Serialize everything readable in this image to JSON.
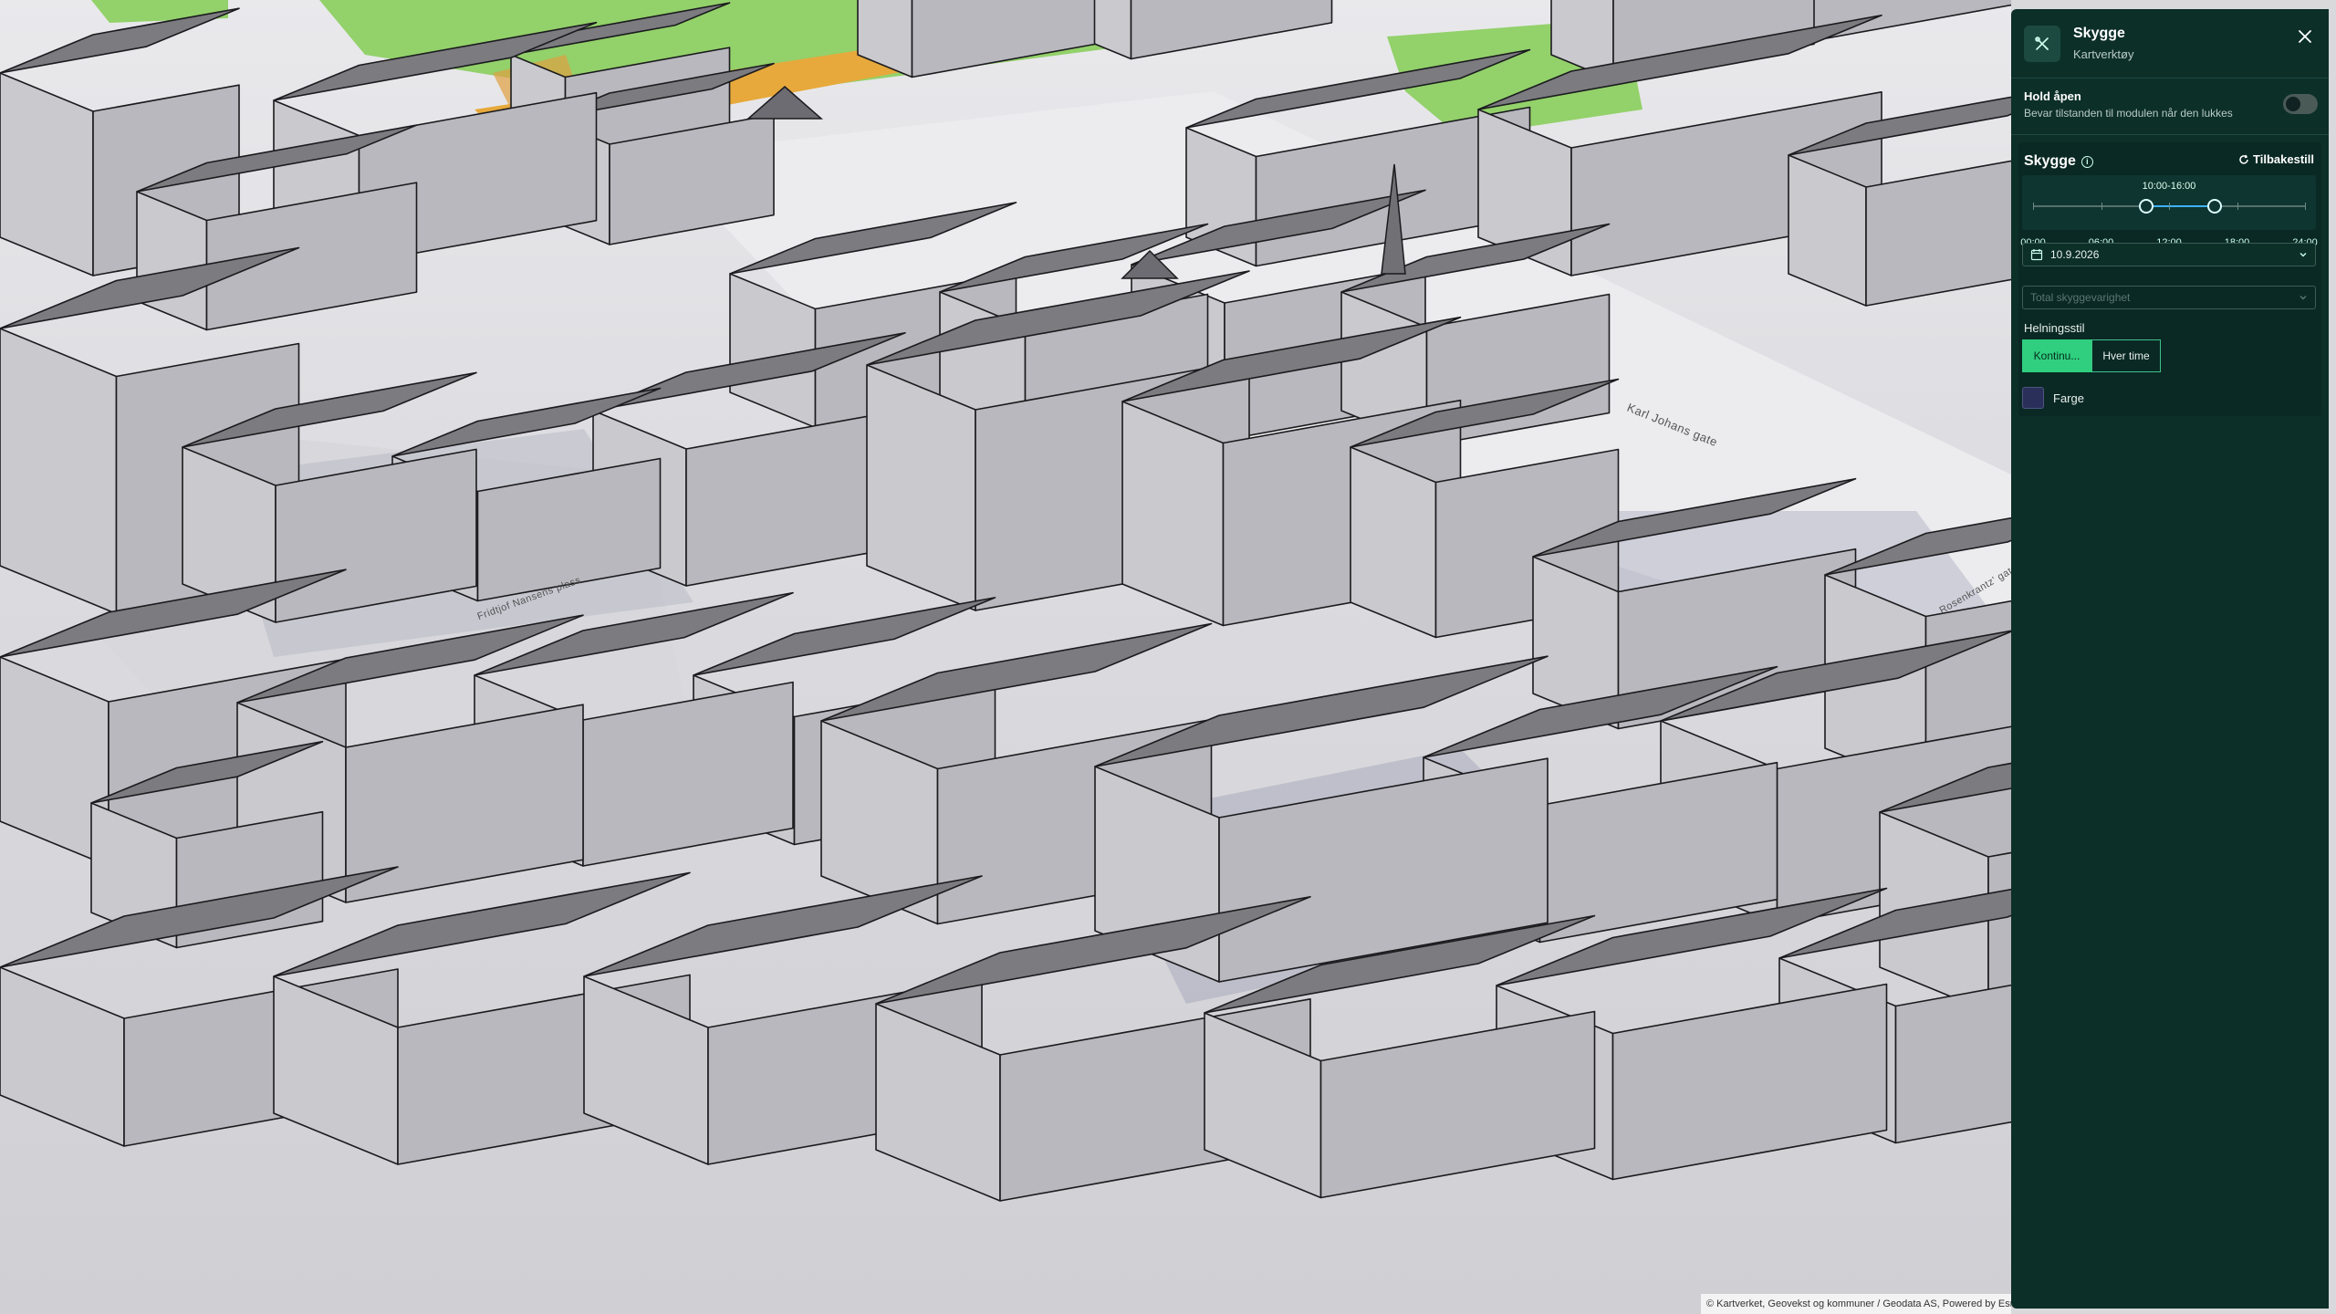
{
  "map": {
    "streets": [
      "Karl Johans gate",
      "Fridtjof Nansens plass",
      "Rosenkrantz' gate"
    ],
    "attribution": "© Kartverket, Geovekst og kommuner / Geodata AS, Powered by Esri",
    "colors": {
      "park": "#93d16b",
      "road": "#e7a93b",
      "roof": "#7b7b80",
      "wall": "#c9c9ce",
      "ground": "#e4e4e7",
      "shadow": "#8a8aa6"
    }
  },
  "panel": {
    "tool_title": "Skygge",
    "tool_subtitle": "Kartverktøy",
    "close_icon": "close-icon",
    "hold_open": {
      "label": "Hold åpen",
      "description": "Bevar tilstanden til modulen når den lukkes",
      "enabled": false
    },
    "shadow": {
      "title": "Skygge",
      "reset_label": "Tilbakestill",
      "range_label": "10:00-16:00",
      "range_start_hour": 10,
      "range_end_hour": 16,
      "ticks": [
        "00:00",
        "06:00",
        "12:00",
        "18:00",
        "24:00"
      ],
      "date": "10.9.2026",
      "mode_placeholder": "Total skyggevarighet",
      "gradient_label": "Helningsstil",
      "gradient_options": [
        "Kontinu...",
        "Hver time"
      ],
      "gradient_selected": 0,
      "color_label": "Farge",
      "color_value": "#2a2f5a"
    }
  }
}
